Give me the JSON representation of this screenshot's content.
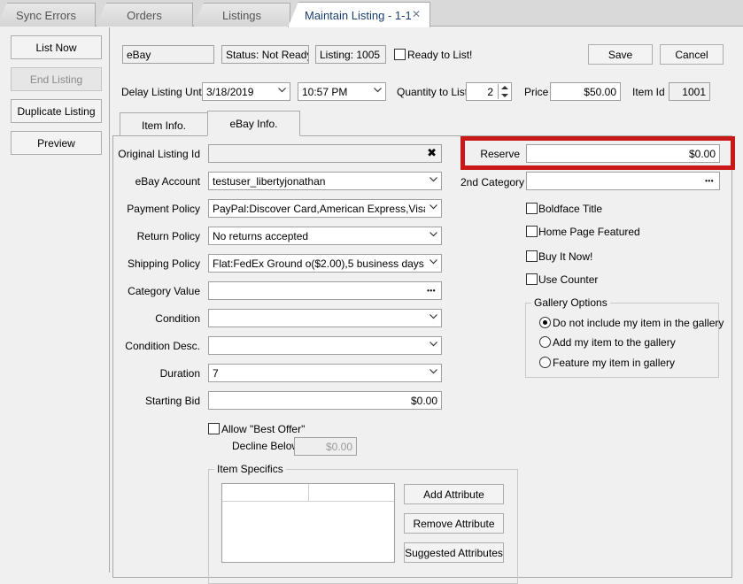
{
  "tabs": [
    {
      "label": "Sync Errors"
    },
    {
      "label": "Orders"
    },
    {
      "label": "Listings"
    },
    {
      "label": "Maintain Listing - 1-1",
      "active": true,
      "close": "✕"
    }
  ],
  "sidebar": {
    "list_now": "List Now",
    "end_listing": "End Listing",
    "duplicate_listing": "Duplicate Listing",
    "preview": "Preview"
  },
  "header": {
    "channel": "eBay",
    "status": "Status: Not Ready",
    "listing": "Listing: 1005",
    "ready_to_list": "Ready to List!",
    "ready_checked": false,
    "save": "Save",
    "cancel": "Cancel"
  },
  "delay": {
    "label": "Delay Listing Until",
    "date": "3/18/2019",
    "time": "10:57 PM",
    "qty_label": "Quantity to List",
    "qty": "2",
    "price_label": "Price",
    "price": "$50.00",
    "item_id_label": "Item Id",
    "item_id": "1001"
  },
  "subtabs": {
    "item_info": "Item Info.",
    "ebay_info": "eBay Info."
  },
  "form": {
    "original_listing_id": {
      "label": "Original Listing Id",
      "value": "",
      "clear_icon": "✖"
    },
    "ebay_account": {
      "label": "eBay Account",
      "value": "testuser_libertyjonathan"
    },
    "payment_policy": {
      "label": "Payment Policy",
      "value": "PayPal:Discover Card,American Express,Visa or"
    },
    "return_policy": {
      "label": "Return Policy",
      "value": "No returns accepted"
    },
    "shipping_policy": {
      "label": "Shipping Policy",
      "value": "Flat:FedEx Ground o($2.00),5 business days"
    },
    "category_value": {
      "label": "Category Value",
      "value": ""
    },
    "condition": {
      "label": "Condition",
      "value": ""
    },
    "condition_desc": {
      "label": "Condition Desc.",
      "value": ""
    },
    "duration": {
      "label": "Duration",
      "value": "7"
    },
    "starting_bid": {
      "label": "Starting Bid",
      "value": "$0.00"
    },
    "allow_best_offer": {
      "label": "Allow \"Best Offer\"",
      "checked": false
    },
    "decline_below": {
      "label": "Decline Below",
      "value": "$0.00"
    },
    "dots": "•••"
  },
  "right": {
    "reserve": {
      "label": "Reserve",
      "value": "$0.00"
    },
    "second_category": {
      "label": "2nd Category",
      "value": ""
    },
    "boldface_title": {
      "label": "Boldface Title",
      "checked": false
    },
    "home_page_featured": {
      "label": "Home Page Featured",
      "checked": false
    },
    "buy_it_now": {
      "label": "Buy It Now!",
      "checked": false
    },
    "use_counter": {
      "label": "Use Counter",
      "checked": false
    },
    "gallery": {
      "title": "Gallery Options",
      "options": [
        {
          "label": "Do not include my item in the gallery",
          "selected": true
        },
        {
          "label": "Add my item to the gallery",
          "selected": false
        },
        {
          "label": "Feature my item in gallery",
          "selected": false
        }
      ]
    }
  },
  "item_specifics": {
    "title": "Item Specifics",
    "add": "Add Attribute",
    "remove": "Remove Attribute",
    "suggested": "Suggested Attributes"
  },
  "colors": {
    "highlight": "#c81818",
    "active_tab_text": "#1a3f6f"
  }
}
